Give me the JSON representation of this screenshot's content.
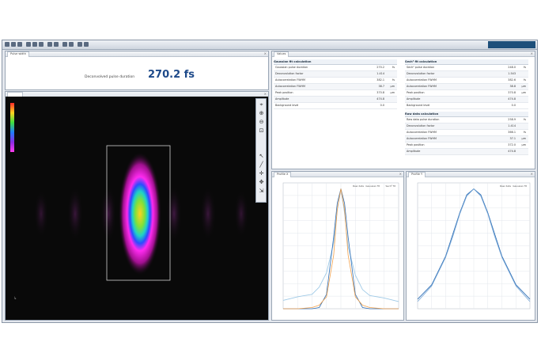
{
  "duration": {
    "tab_label": "Pulse width",
    "label": "Deconvolved pulse duration",
    "value": "270.2 fs"
  },
  "results": {
    "tab_label": "Values",
    "sections": [
      {
        "title": "Gaussian fit calculation",
        "rows": [
          {
            "name": "Gaussian pulse duration",
            "value": "270.2",
            "unit": "fs"
          },
          {
            "name": "Deconvolution factor",
            "value": "1.414",
            "unit": ""
          },
          {
            "name": "Autocorrelation FWHM",
            "value": "382.1",
            "unit": "fs"
          },
          {
            "name": "Autocorrelation FWHM",
            "value": "38.7",
            "unit": "µm"
          },
          {
            "name": "Peak position",
            "value": "370.8",
            "unit": "µm"
          },
          {
            "name": "Amplitude",
            "value": "474.8",
            "unit": ""
          },
          {
            "name": "Background level",
            "value": "0.0",
            "unit": ""
          }
        ]
      },
      {
        "title": "Sech² fit calculation",
        "rows": [
          {
            "name": "Sech² pulse duration",
            "value": "248.0",
            "unit": "fs"
          },
          {
            "name": "Deconvolution factor",
            "value": "1.543",
            "unit": ""
          },
          {
            "name": "Autocorrelation FWHM",
            "value": "382.6",
            "unit": "fs"
          },
          {
            "name": "Autocorrelation FWHM",
            "value": "38.8",
            "unit": "µm"
          },
          {
            "name": "Peak position",
            "value": "370.8",
            "unit": "µm"
          },
          {
            "name": "Amplitude",
            "value": "474.8",
            "unit": ""
          },
          {
            "name": "Background level",
            "value": "0.0",
            "unit": ""
          }
        ]
      },
      {
        "title": "Raw data calculation",
        "rows": [
          {
            "name": "Raw data pulse duration",
            "value": "258.9",
            "unit": "fs"
          },
          {
            "name": "Deconvolution factor",
            "value": "1.414",
            "unit": ""
          },
          {
            "name": "Autocorrelation FWHM",
            "value": "366.1",
            "unit": "fs"
          },
          {
            "name": "Autocorrelation FWHM",
            "value": "37.1",
            "unit": "µm"
          },
          {
            "name": "Peak position",
            "value": "372.0",
            "unit": "µm"
          },
          {
            "name": "Amplitude",
            "value": "474.8",
            "unit": ""
          }
        ]
      }
    ]
  },
  "charts": {
    "left_tab": "Profile X",
    "right_tab": "Profile Y",
    "left_legend": [
      "Raw data",
      "Gaussian fit",
      "Sech² fit"
    ],
    "right_legend": [
      "Raw data",
      "Gaussian fit"
    ]
  },
  "chart_data": [
    {
      "type": "line",
      "title": "",
      "series": [
        {
          "name": "Raw data",
          "color": "#9ec9e6",
          "x": [
            -8,
            -6,
            -4,
            -3,
            -2,
            -1,
            -0.5,
            0,
            0.5,
            1,
            2,
            3,
            4,
            6,
            8
          ],
          "values": [
            0.07,
            0.1,
            0.12,
            0.18,
            0.3,
            0.55,
            0.82,
            1,
            0.8,
            0.52,
            0.28,
            0.16,
            0.11,
            0.09,
            0.06
          ]
        },
        {
          "name": "Gaussian fit",
          "color": "#2f6fb6",
          "x": [
            -8,
            -6,
            -4,
            -3,
            -2,
            -1,
            -0.5,
            0,
            0.5,
            1,
            2,
            3,
            4,
            6,
            8
          ],
          "values": [
            0,
            0,
            0,
            0.01,
            0.12,
            0.6,
            0.88,
            1,
            0.88,
            0.6,
            0.12,
            0.01,
            0,
            0,
            0
          ]
        },
        {
          "name": "Sech² fit",
          "color": "#f2a04a",
          "x": [
            -8,
            -6,
            -4,
            -3,
            -2,
            -1,
            -0.5,
            0,
            0.5,
            1,
            2,
            3,
            4,
            6,
            8
          ],
          "values": [
            0,
            0,
            0.01,
            0.03,
            0.1,
            0.45,
            0.83,
            1,
            0.83,
            0.45,
            0.1,
            0.03,
            0.01,
            0,
            0
          ]
        }
      ],
      "xlim": [
        -8,
        8
      ],
      "ylim": [
        0,
        1.05
      ],
      "grid": true,
      "legend": "top-right"
    },
    {
      "type": "line",
      "title": "",
      "series": [
        {
          "name": "Raw data",
          "color": "#2f6fb6",
          "x": [
            -8,
            -6,
            -4,
            -3,
            -2,
            -1,
            0,
            1,
            2,
            3,
            4,
            6,
            8
          ],
          "values": [
            0.08,
            0.2,
            0.44,
            0.62,
            0.8,
            0.95,
            1,
            0.95,
            0.8,
            0.62,
            0.44,
            0.2,
            0.08
          ]
        },
        {
          "name": "Gaussian fit",
          "color": "#7aa9d8",
          "x": [
            -8,
            -6,
            -4,
            -3,
            -2,
            -1,
            0,
            1,
            2,
            3,
            4,
            6,
            8
          ],
          "values": [
            0.06,
            0.19,
            0.43,
            0.6,
            0.79,
            0.94,
            1,
            0.94,
            0.79,
            0.6,
            0.43,
            0.19,
            0.06
          ]
        }
      ],
      "xlim": [
        -8,
        8
      ],
      "ylim": [
        0,
        1.05
      ],
      "grid": true,
      "legend": "top-right"
    }
  ]
}
